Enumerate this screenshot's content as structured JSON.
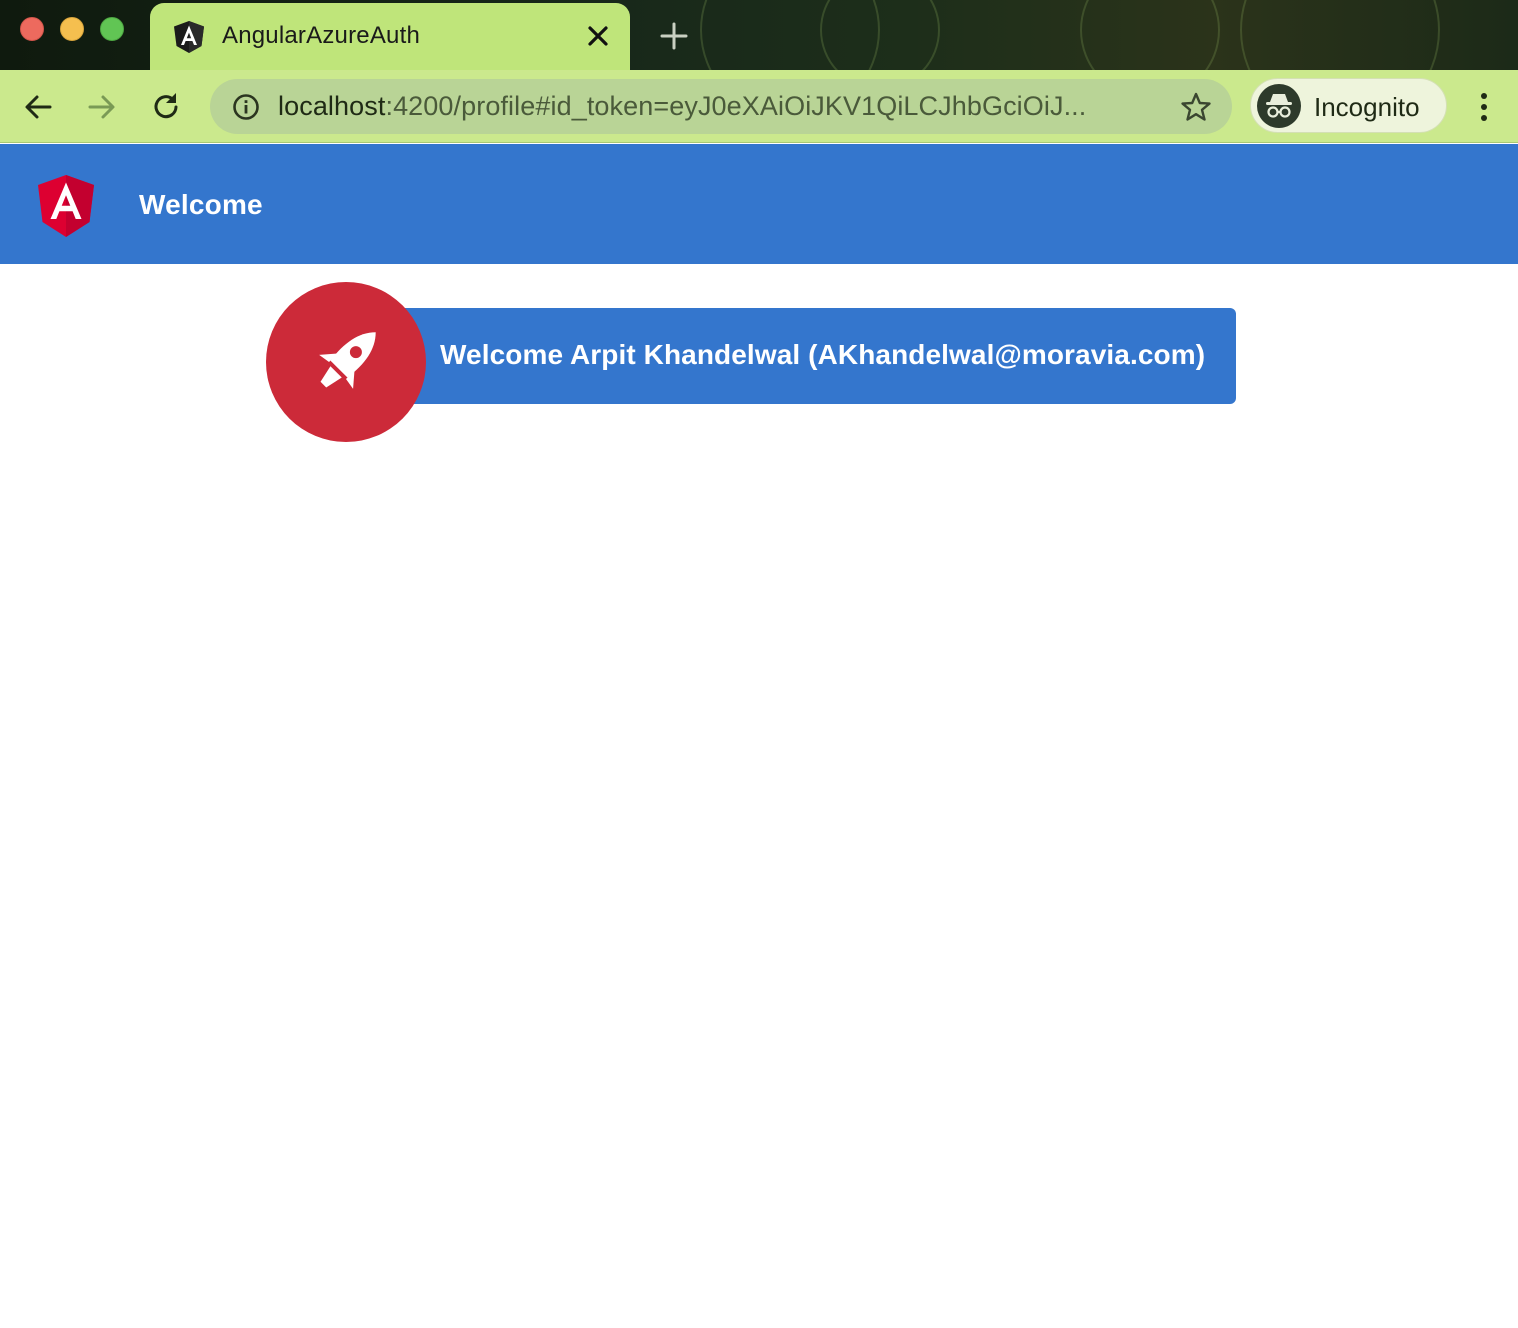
{
  "browser": {
    "tab": {
      "title": "AngularAzureAuth",
      "favicon": "angular-icon"
    },
    "address_bar": {
      "host": "localhost",
      "rest": ":4200/profile#id_token=eyJ0eXAiOiJKV1QiLCJhbGciOiJ..."
    },
    "profile": {
      "label": "Incognito",
      "icon": "incognito-icon"
    }
  },
  "app": {
    "header": {
      "title": "Welcome",
      "logo": "angular-logo"
    },
    "welcome_card": {
      "message": "Welcome Arpit Khandelwal (AKhandelwal@moravia.com)",
      "icon": "rocket-icon"
    }
  },
  "colors": {
    "header_blue": "#3476cd",
    "badge_red": "#cc2a39",
    "tab_green": "#bfe57a",
    "toolbar_green": "#cbe98d"
  }
}
